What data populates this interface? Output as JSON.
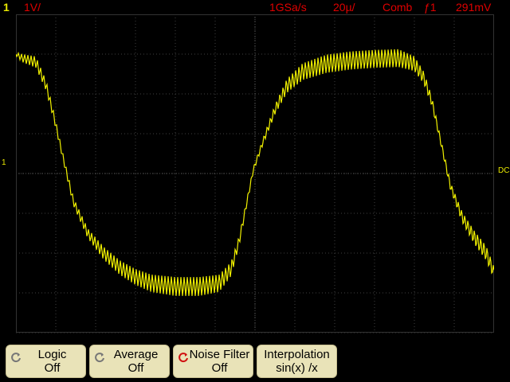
{
  "status": {
    "channel": "1",
    "channel_scale": "1V/",
    "sample_rate": "1GSa/s",
    "time_scale": "20µ/",
    "acq_mode": "Comb",
    "trigger_source": "ƒ1",
    "trigger_level": "291mV"
  },
  "markers": {
    "ch1_ground": "1",
    "trigger_level_marker": "DC"
  },
  "softkeys": [
    {
      "label": "Logic",
      "value": "Off",
      "icon": "rotate-knob-icon"
    },
    {
      "label": "Average",
      "value": "Off",
      "icon": "rotate-knob-icon"
    },
    {
      "label": "Noise Filter",
      "value": "Off",
      "icon": "rotate-knob-icon-red"
    },
    {
      "label": "Interpolation",
      "value": "sin(x) /x",
      "icon": ""
    }
  ],
  "colors": {
    "trace": "#f0f000",
    "status_red": "#e00000",
    "softkey_bg": "#e9e3b8",
    "grid": "#404040"
  }
}
